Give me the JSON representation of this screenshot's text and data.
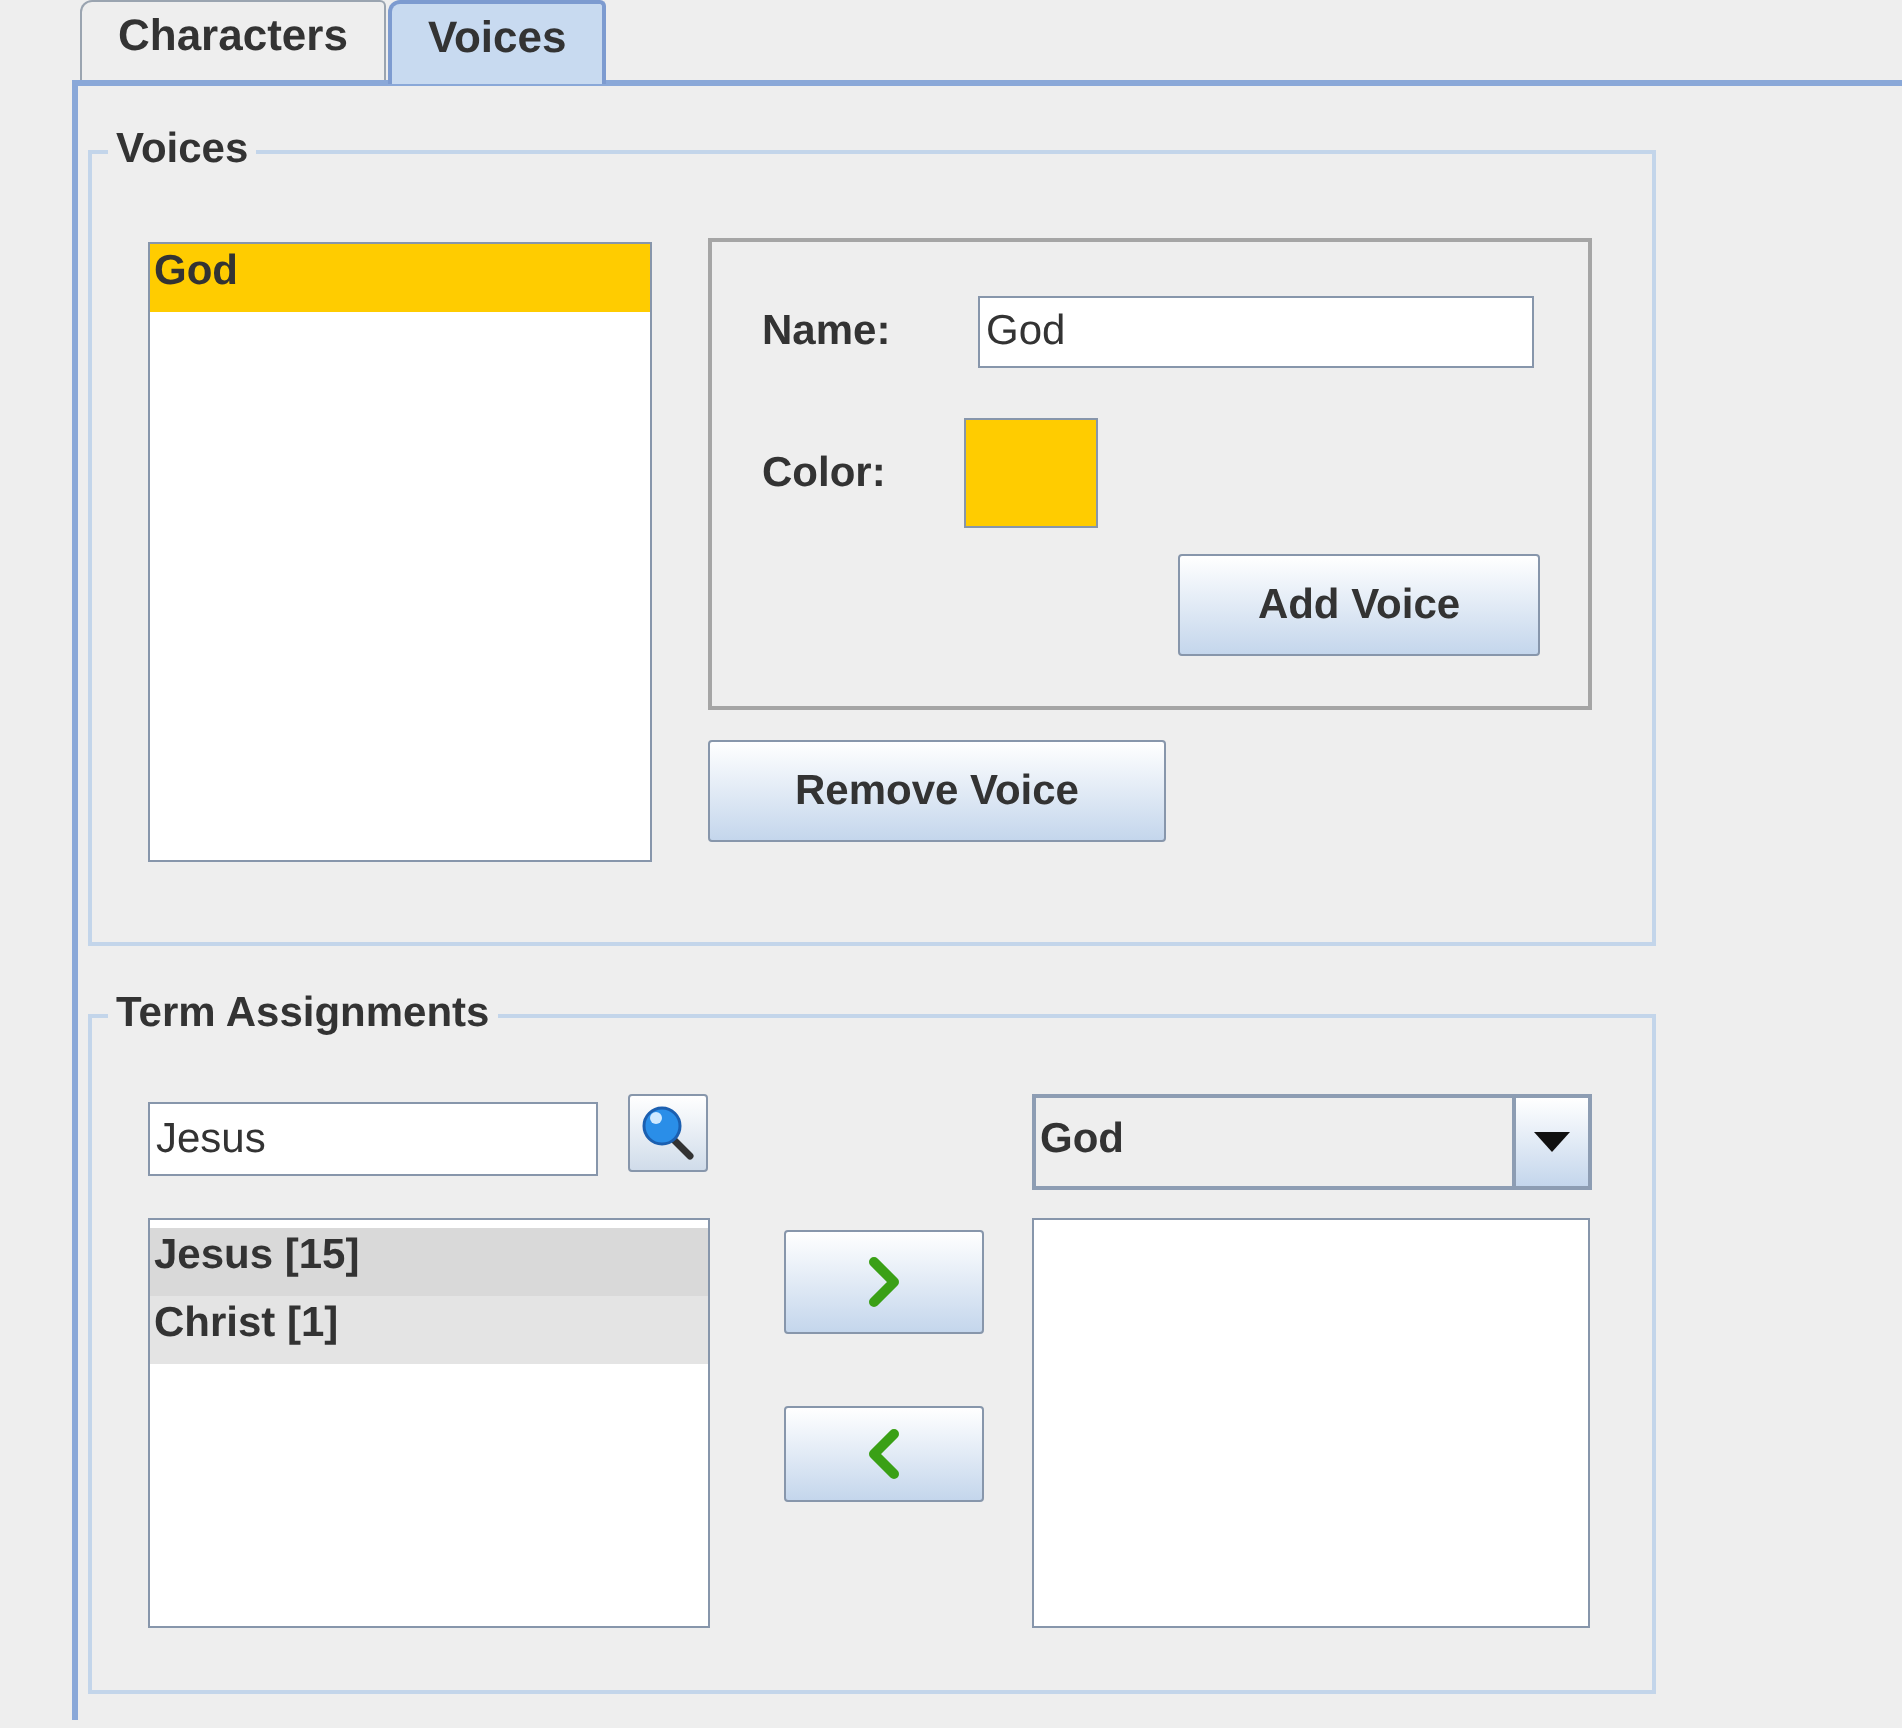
{
  "tabs": [
    {
      "label": "Characters",
      "selected": false
    },
    {
      "label": "Voices",
      "selected": true
    }
  ],
  "voices_group": {
    "title": "Voices",
    "voices": [
      {
        "name": "God",
        "color": "#ffcc00",
        "selected": true
      }
    ],
    "editor": {
      "name_label": "Name:",
      "name_value": "God",
      "color_label": "Color:",
      "color": "#ffcc00",
      "add_button": "Add Voice"
    },
    "remove_button": "Remove Voice"
  },
  "term_group": {
    "title": "Term Assignments",
    "search": {
      "value": "Jesus"
    },
    "terms": [
      {
        "label": "Jesus [15]"
      },
      {
        "label": "Christ [1]"
      }
    ],
    "voice_combo": {
      "value": "God"
    }
  }
}
